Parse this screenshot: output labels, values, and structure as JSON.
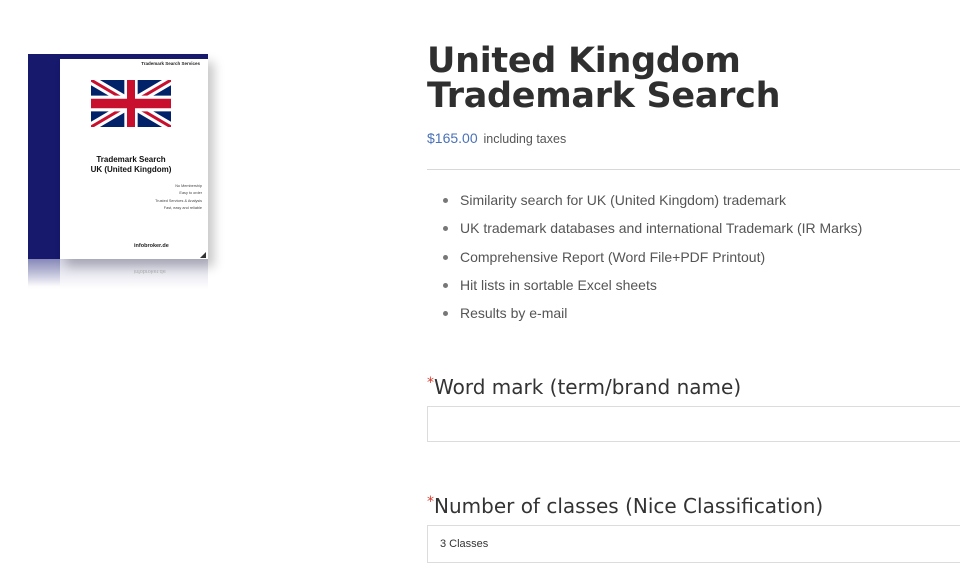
{
  "product_box": {
    "top_label": "Trademark Search Services",
    "title_line1": "Trademark Search",
    "title_line2": "UK (United Kingdom)",
    "features": [
      "No Membership",
      "Easy to order",
      "Trusted Services & Analysis",
      "Fast, easy and reliable"
    ],
    "brand": "infobroker.de",
    "spine_color": "#16196c"
  },
  "product": {
    "title": "United Kingdom Trademark Search",
    "price": "$165.00",
    "tax_note": "including taxes",
    "features": [
      "Similarity search for UK (United Kingdom) trademark",
      "UK trademark databases and international Trademark (IR Marks)",
      "Comprehensive Report (Word File+PDF Printout)",
      "Hit lists in sortable Excel sheets",
      "Results by e-mail"
    ]
  },
  "form": {
    "required_marker": "*",
    "word_mark_label": "Word mark (term/brand name)",
    "word_mark_value": "",
    "classes_label": "Number of classes (Nice Classification)",
    "classes_selected": "3 Classes"
  },
  "colors": {
    "price": "#4a72b8",
    "required": "#d93a2b",
    "title": "#2f2f2f"
  }
}
